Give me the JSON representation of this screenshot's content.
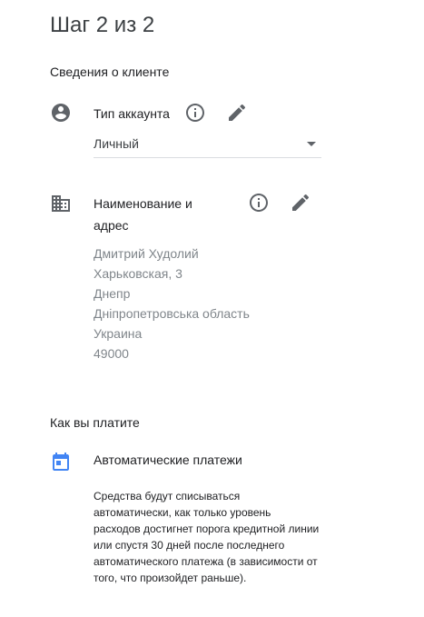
{
  "step_title": "Шаг 2 из 2",
  "client_section": {
    "heading": "Сведения о клиенте",
    "account_type": {
      "label": "Тип аккаунта",
      "value": "Личный",
      "icon": "account-circle-icon"
    },
    "name_address": {
      "label_line1": "Наименование и",
      "label_line2": "адрес",
      "icon": "business-building-icon",
      "lines": [
        "Дмитрий Худолий",
        "Харьковская, 3",
        "Днепр",
        "Дніпропетровська область",
        "Украина",
        "49000"
      ]
    }
  },
  "payment_section": {
    "heading": "Как вы платите",
    "method": {
      "label": "Автоматические платежи",
      "icon": "calendar-icon",
      "description": "Средства будут списываться автоматически, как только уровень расходов достигнет порога кредитной линии или спустя 30 дней после последнего автоматического платежа (в зависимости от того, что произойдет раньше)."
    }
  },
  "colors": {
    "icon_gray": "#5f6368",
    "calendar_blue": "#4285f4",
    "muted_text": "#80868b",
    "divider": "#dadce0"
  }
}
